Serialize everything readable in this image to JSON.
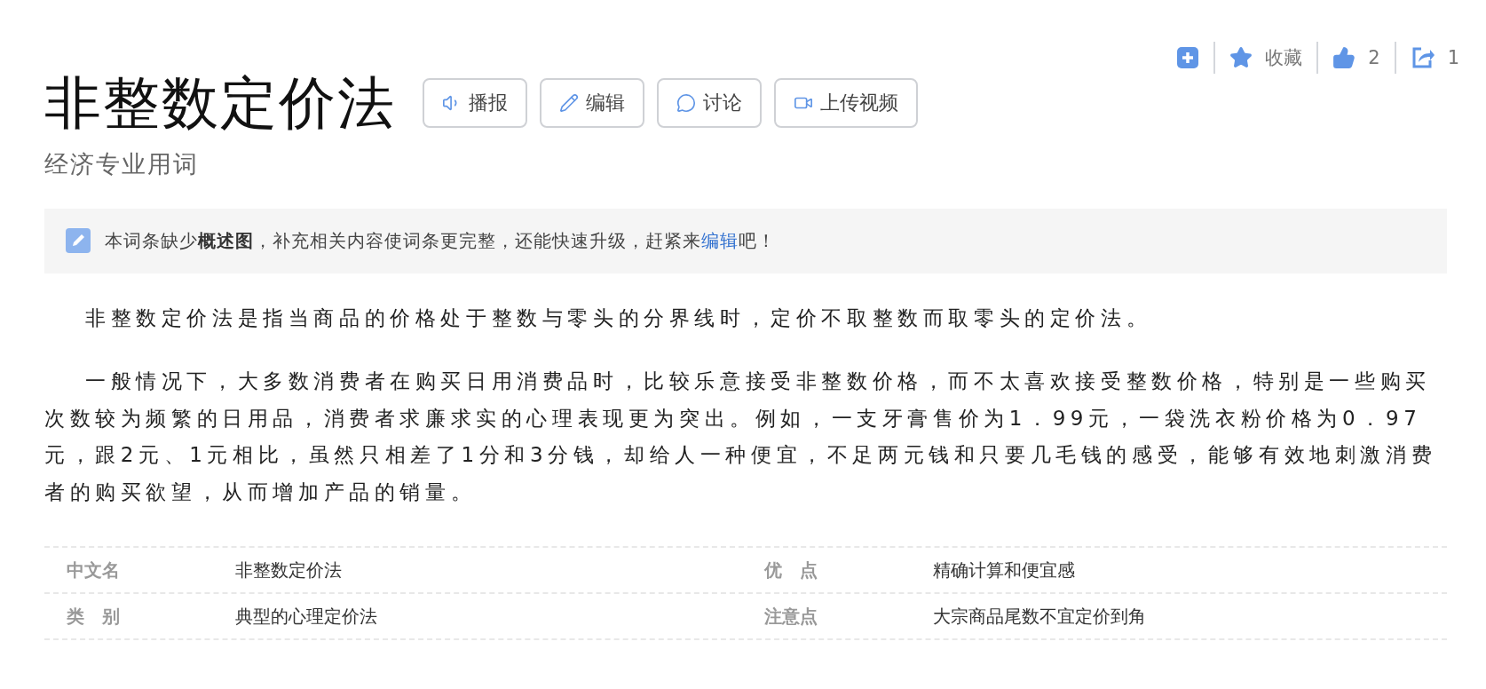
{
  "top_actions": [
    {
      "kind": "add"
    },
    {
      "kind": "favorite",
      "label": "收藏"
    },
    {
      "kind": "like",
      "label": "2"
    },
    {
      "kind": "share",
      "label": "1"
    }
  ],
  "title": "非整数定价法",
  "actions": [
    {
      "kind": "speaker",
      "label": "播报"
    },
    {
      "kind": "edit",
      "label": "编辑"
    },
    {
      "kind": "discuss",
      "label": "讨论"
    },
    {
      "kind": "video",
      "label": "上传视频"
    }
  ],
  "subtitle": "经济专业用词",
  "notice": {
    "text": "本词条缺少**概述图**，补充相关内容使词条更完整，还能快速升级，赶紧来",
    "link": "编辑",
    "after": "吧！"
  },
  "paragraphs": [
    "非整数定价法是指当商品的价格处于整数与零头的分界线时，定价不取整数而取零头的定价法。",
    "一般情况下，大多数消费者在购买日用消费品时，比较乐意接受非整数价格，而不太喜欢接受整数价格，特别是一些购买次数较为频繁的日用品，消费者求廉求实的心理表现更为突出。例如，一支牙膏售价为1．99元，一袋洗衣粉价格为0．97元，跟2元、1元相比，虽然只相差了1分和3分钱，却给人一种便宜，不足两元钱和只要几毛钱的感受，能够有效地刺激消费者的购买欲望，从而增加产品的销量。"
  ],
  "infobox": [
    [
      {
        "label": "中文名",
        "value": "非整数定价法"
      },
      {
        "label": "优　点",
        "value": "精确计算和便宜感"
      }
    ],
    [
      {
        "label": "类　别",
        "value": "典型的心理定价法"
      },
      {
        "label": "注意点",
        "value": "大宗商品尾数不宜定价到角"
      }
    ]
  ]
}
